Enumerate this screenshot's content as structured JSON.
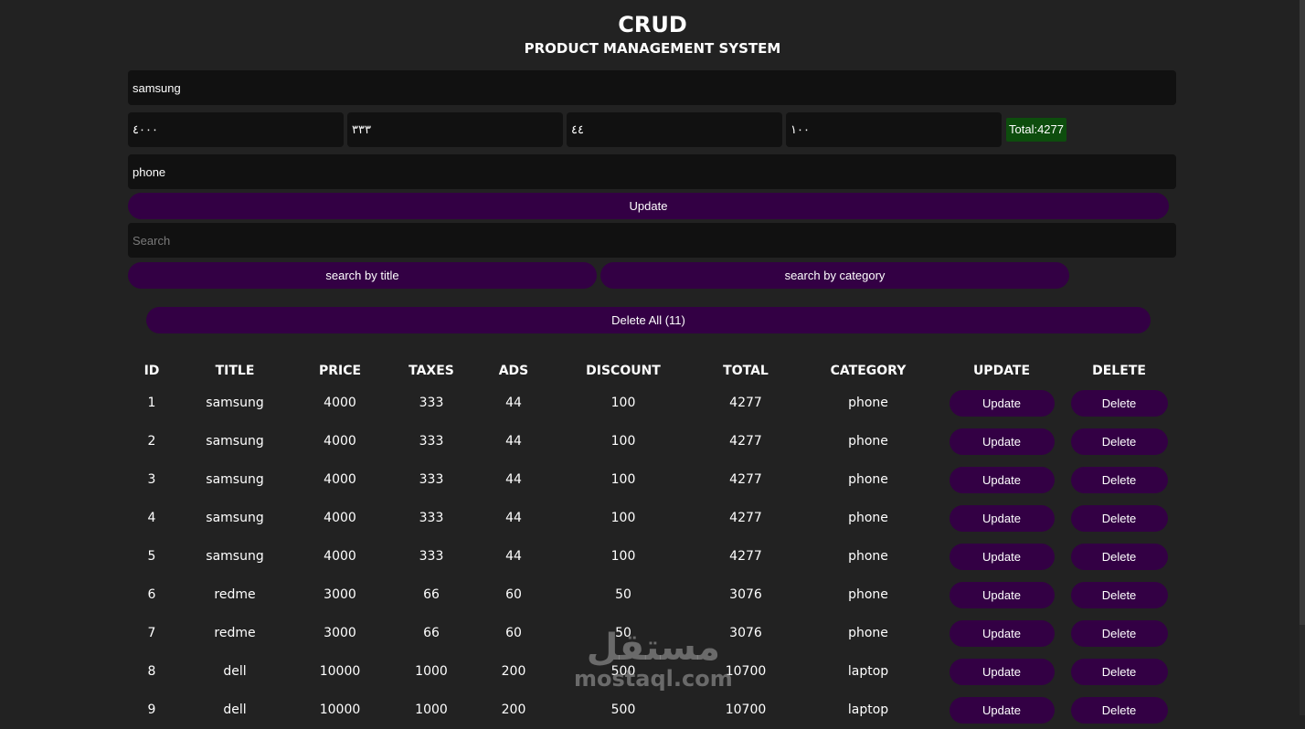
{
  "header": {
    "title": "CRUD",
    "subtitle": "PRODUCT MANAGEMENT SYSTEM"
  },
  "form": {
    "title_value": "samsung",
    "price_value": "٤٠٠٠",
    "taxes_value": "٣٣٣",
    "ads_value": "٤٤",
    "discount_value": "١٠٠",
    "total_label": "Total:4277",
    "category_value": "phone",
    "submit_label": "Update",
    "search_placeholder": "Search",
    "search_title_label": "search by title",
    "search_category_label": "search by category",
    "delete_all_label": "Delete All (11)"
  },
  "table": {
    "columns": [
      "ID",
      "TITLE",
      "PRICE",
      "TAXES",
      "ADS",
      "DISCOUNT",
      "TOTAL",
      "CATEGORY",
      "UPDATE",
      "DELETE"
    ],
    "update_label": "Update",
    "delete_label": "Delete",
    "rows": [
      [
        "1",
        "samsung",
        "4000",
        "333",
        "44",
        "100",
        "4277",
        "phone"
      ],
      [
        "2",
        "samsung",
        "4000",
        "333",
        "44",
        "100",
        "4277",
        "phone"
      ],
      [
        "3",
        "samsung",
        "4000",
        "333",
        "44",
        "100",
        "4277",
        "phone"
      ],
      [
        "4",
        "samsung",
        "4000",
        "333",
        "44",
        "100",
        "4277",
        "phone"
      ],
      [
        "5",
        "samsung",
        "4000",
        "333",
        "44",
        "100",
        "4277",
        "phone"
      ],
      [
        "6",
        "redme",
        "3000",
        "66",
        "60",
        "50",
        "3076",
        "phone"
      ],
      [
        "7",
        "redme",
        "3000",
        "66",
        "60",
        "50",
        "3076",
        "phone"
      ],
      [
        "8",
        "dell",
        "10000",
        "1000",
        "200",
        "500",
        "10700",
        "laptop"
      ],
      [
        "9",
        "dell",
        "10000",
        "1000",
        "200",
        "500",
        "10700",
        "laptop"
      ]
    ]
  },
  "watermark": {
    "arabic": "مستقل",
    "latin": "mostaql.com"
  },
  "colors": {
    "background": "#222222",
    "field": "#111111",
    "button": "#330044",
    "total_badge": "#0d4d0d"
  }
}
